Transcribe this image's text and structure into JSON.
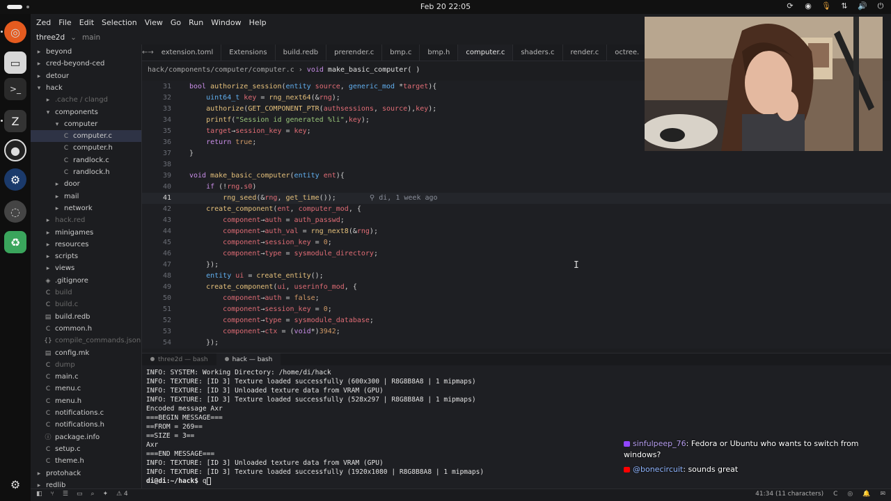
{
  "topbar": {
    "clock": "Feb 20  22:05"
  },
  "menu": [
    "Zed",
    "File",
    "Edit",
    "Selection",
    "View",
    "Go",
    "Run",
    "Window",
    "Help"
  ],
  "title": {
    "project": "three2d",
    "branch": "main"
  },
  "project_tree": [
    {
      "label": "beyond",
      "icon": "folder-icon",
      "indent": 0,
      "ignored": false
    },
    {
      "label": "cred-beyond-ced",
      "icon": "folder-icon",
      "indent": 0,
      "ignored": false
    },
    {
      "label": "detour",
      "icon": "folder-icon",
      "indent": 0,
      "ignored": false
    },
    {
      "label": "hack",
      "icon": "folder-open-icon",
      "indent": 0,
      "ignored": false
    },
    {
      "label": ".cache / clangd",
      "icon": "folder-icon",
      "indent": 1,
      "ignored": true
    },
    {
      "label": "components",
      "icon": "folder-open-icon",
      "indent": 1,
      "ignored": false
    },
    {
      "label": "computer",
      "icon": "folder-open-icon",
      "indent": 2,
      "ignored": false
    },
    {
      "label": "computer.c",
      "icon": "c-file-icon",
      "indent": 3,
      "ignored": false,
      "selected": true
    },
    {
      "label": "computer.h",
      "icon": "c-file-icon",
      "indent": 3,
      "ignored": false
    },
    {
      "label": "randlock.c",
      "icon": "c-file-icon",
      "indent": 3,
      "ignored": false
    },
    {
      "label": "randlock.h",
      "icon": "c-file-icon",
      "indent": 3,
      "ignored": false
    },
    {
      "label": "door",
      "icon": "folder-icon",
      "indent": 2,
      "ignored": false
    },
    {
      "label": "mail",
      "icon": "folder-icon",
      "indent": 2,
      "ignored": false
    },
    {
      "label": "network",
      "icon": "folder-icon",
      "indent": 2,
      "ignored": false
    },
    {
      "label": "hack.red",
      "icon": "folder-icon",
      "indent": 1,
      "ignored": true
    },
    {
      "label": "minigames",
      "icon": "folder-icon",
      "indent": 1,
      "ignored": false
    },
    {
      "label": "resources",
      "icon": "folder-icon",
      "indent": 1,
      "ignored": false
    },
    {
      "label": "scripts",
      "icon": "folder-icon",
      "indent": 1,
      "ignored": false
    },
    {
      "label": "views",
      "icon": "folder-icon",
      "indent": 1,
      "ignored": false
    },
    {
      "label": ".gitignore",
      "icon": "git-icon",
      "indent": 1,
      "ignored": false
    },
    {
      "label": "build",
      "icon": "c-file-icon",
      "indent": 1,
      "ignored": true
    },
    {
      "label": "build.c",
      "icon": "c-file-icon",
      "indent": 1,
      "ignored": true
    },
    {
      "label": "build.redb",
      "icon": "file-icon",
      "indent": 1,
      "ignored": false
    },
    {
      "label": "common.h",
      "icon": "c-file-icon",
      "indent": 1,
      "ignored": false
    },
    {
      "label": "compile_commands.json",
      "icon": "json-icon",
      "indent": 1,
      "ignored": true
    },
    {
      "label": "config.mk",
      "icon": "file-icon",
      "indent": 1,
      "ignored": false
    },
    {
      "label": "dump",
      "icon": "c-file-icon",
      "indent": 1,
      "ignored": true
    },
    {
      "label": "main.c",
      "icon": "c-file-icon",
      "indent": 1,
      "ignored": false
    },
    {
      "label": "menu.c",
      "icon": "c-file-icon",
      "indent": 1,
      "ignored": false
    },
    {
      "label": "menu.h",
      "icon": "c-file-icon",
      "indent": 1,
      "ignored": false
    },
    {
      "label": "notifications.c",
      "icon": "c-file-icon",
      "indent": 1,
      "ignored": false
    },
    {
      "label": "notifications.h",
      "icon": "c-file-icon",
      "indent": 1,
      "ignored": false
    },
    {
      "label": "package.info",
      "icon": "info-icon",
      "indent": 1,
      "ignored": false
    },
    {
      "label": "setup.c",
      "icon": "c-file-icon",
      "indent": 1,
      "ignored": false
    },
    {
      "label": "theme.h",
      "icon": "c-file-icon",
      "indent": 1,
      "ignored": false
    },
    {
      "label": "protohack",
      "icon": "folder-icon",
      "indent": 0,
      "ignored": false
    },
    {
      "label": "redlib",
      "icon": "folder-icon",
      "indent": 0,
      "ignored": false
    }
  ],
  "tabs": [
    {
      "label": "extension.toml",
      "active": false
    },
    {
      "label": "Extensions",
      "active": false
    },
    {
      "label": "build.redb",
      "active": false
    },
    {
      "label": "prerender.c",
      "active": false
    },
    {
      "label": "bmp.c",
      "active": false
    },
    {
      "label": "bmp.h",
      "active": false
    },
    {
      "label": "computer.c",
      "active": true
    },
    {
      "label": "shaders.c",
      "active": false
    },
    {
      "label": "render.c",
      "active": false
    },
    {
      "label": "octree.",
      "active": false
    }
  ],
  "breadcrumb": {
    "path": "hack/components/computer/computer.c",
    "ret": "void",
    "fn": "make_basic_computer( )"
  },
  "code_lines": [
    {
      "n": "31",
      "html": "<span class=\"k\">bool</span> <span class=\"f\">authorize_session</span>(<span class=\"t\">entity</span> <span class=\"v\">source</span>, <span class=\"t\">generic_mod</span> *<span class=\"v\">target</span>){"
    },
    {
      "n": "32",
      "html": "    <span class=\"t\">uint64_t</span> <span class=\"v\">key</span> = <span class=\"f\">rng_next64</span>(&amp;<span class=\"v\">rng</span>);"
    },
    {
      "n": "33",
      "html": "    <span class=\"f\">authorize</span>(<span class=\"f\">GET_COMPONENT_PTR</span>(<span class=\"v\">authsessions</span>, <span class=\"v\">source</span>),<span class=\"v\">key</span>);"
    },
    {
      "n": "34",
      "html": "    <span class=\"f\">printf</span>(<span class=\"s\">\"Session id generated %li\"</span>,<span class=\"v\">key</span>);"
    },
    {
      "n": "35",
      "html": "    <span class=\"v\">target</span>→<span class=\"v\">session_key</span> = <span class=\"v\">key</span>;"
    },
    {
      "n": "36",
      "html": "    <span class=\"k\">return</span> <span class=\"n\">true</span>;"
    },
    {
      "n": "37",
      "html": "}"
    },
    {
      "n": "38",
      "html": ""
    },
    {
      "n": "39",
      "html": "<span class=\"k\">void</span> <span class=\"f\">make_basic_computer</span>(<span class=\"t\">entity</span> <span class=\"v\">ent</span>){"
    },
    {
      "n": "40",
      "html": "    <span class=\"k\">if</span> (!<span class=\"v\">rng</span>.<span class=\"v\">s0</span>)"
    },
    {
      "n": "41",
      "html": "        <span class=\"f\">rng_seed</span>(&amp;<span class=\"v\">rng</span>, <span class=\"f\">get_time</span>());        <span class=\"blame\">⚲ di, 1 week ago</span>",
      "current": true
    },
    {
      "n": "42",
      "html": "    <span class=\"f\">create_component</span>(<span class=\"v\">ent</span>, <span class=\"v\">computer_mod</span>, {"
    },
    {
      "n": "43",
      "html": "        <span class=\"v\">component</span>→<span class=\"v\">auth</span> = <span class=\"v\">auth_passwd</span>;"
    },
    {
      "n": "44",
      "html": "        <span class=\"v\">component</span>→<span class=\"v\">auth_val</span> = <span class=\"f\">rng_next8</span>(&amp;<span class=\"v\">rng</span>);"
    },
    {
      "n": "45",
      "html": "        <span class=\"v\">component</span>→<span class=\"v\">session_key</span> = <span class=\"n\">0</span>;"
    },
    {
      "n": "46",
      "html": "        <span class=\"v\">component</span>→<span class=\"v\">type</span> = <span class=\"v\">sysmodule_directory</span>;"
    },
    {
      "n": "47",
      "html": "    });"
    },
    {
      "n": "48",
      "html": "    <span class=\"t\">entity</span> <span class=\"v\">ui</span> = <span class=\"f\">create_entity</span>();"
    },
    {
      "n": "49",
      "html": "    <span class=\"f\">create_component</span>(<span class=\"v\">ui</span>, <span class=\"v\">userinfo_mod</span>, {"
    },
    {
      "n": "50",
      "html": "        <span class=\"v\">component</span>→<span class=\"v\">auth</span> = <span class=\"n\">false</span>;"
    },
    {
      "n": "51",
      "html": "        <span class=\"v\">component</span>→<span class=\"v\">session_key</span> = <span class=\"n\">0</span>;"
    },
    {
      "n": "52",
      "html": "        <span class=\"v\">component</span>→<span class=\"v\">type</span> = <span class=\"v\">sysmodule_database</span>;"
    },
    {
      "n": "53",
      "html": "        <span class=\"v\">component</span>→<span class=\"v\">ctx</span> = (<span class=\"k\">void</span>*)<span class=\"n\">3942</span>;"
    },
    {
      "n": "54",
      "html": "    });"
    }
  ],
  "terminal_tabs": [
    {
      "label": "three2d — bash",
      "active": false
    },
    {
      "label": "hack — bash",
      "active": true
    }
  ],
  "terminal_lines": [
    "INFO: SYSTEM: Working Directory: /home/di/hack",
    "INFO: TEXTURE: [ID 3] Texture loaded successfully (600x300 | R8G8B8A8 | 1 mipmaps)",
    "INFO: TEXTURE: [ID 3] Unloaded texture data from VRAM (GPU)",
    "INFO: TEXTURE: [ID 3] Texture loaded successfully (528x297 | R8G8B8A8 | 1 mipmaps)",
    "Encoded message Axr",
    "===BEGIN MESSAGE===",
    "==FROM = 269==",
    "==SIZE = 3==",
    "Axr",
    "===END MESSAGE===",
    "INFO: TEXTURE: [ID 3] Unloaded texture data from VRAM (GPU)",
    "INFO: TEXTURE: [ID 3] Texture loaded successfully (1920x1080 | R8G8B8A8 | 1 mipmaps)"
  ],
  "terminal_prompt": {
    "ps1": "di@di:~/hack$",
    "input": "q"
  },
  "chat": [
    {
      "user": "sinfulpeep_76",
      "text": "Fedora or Ubuntu who wants to switch from windows?",
      "badge_color": "#9146ff"
    },
    {
      "user": "@bonecircuit",
      "text": "sounds great",
      "badge_color": "#ff0000"
    }
  ],
  "status": {
    "diagnostics": "4",
    "position": "41:34 (11 characters)",
    "lang": "C"
  }
}
